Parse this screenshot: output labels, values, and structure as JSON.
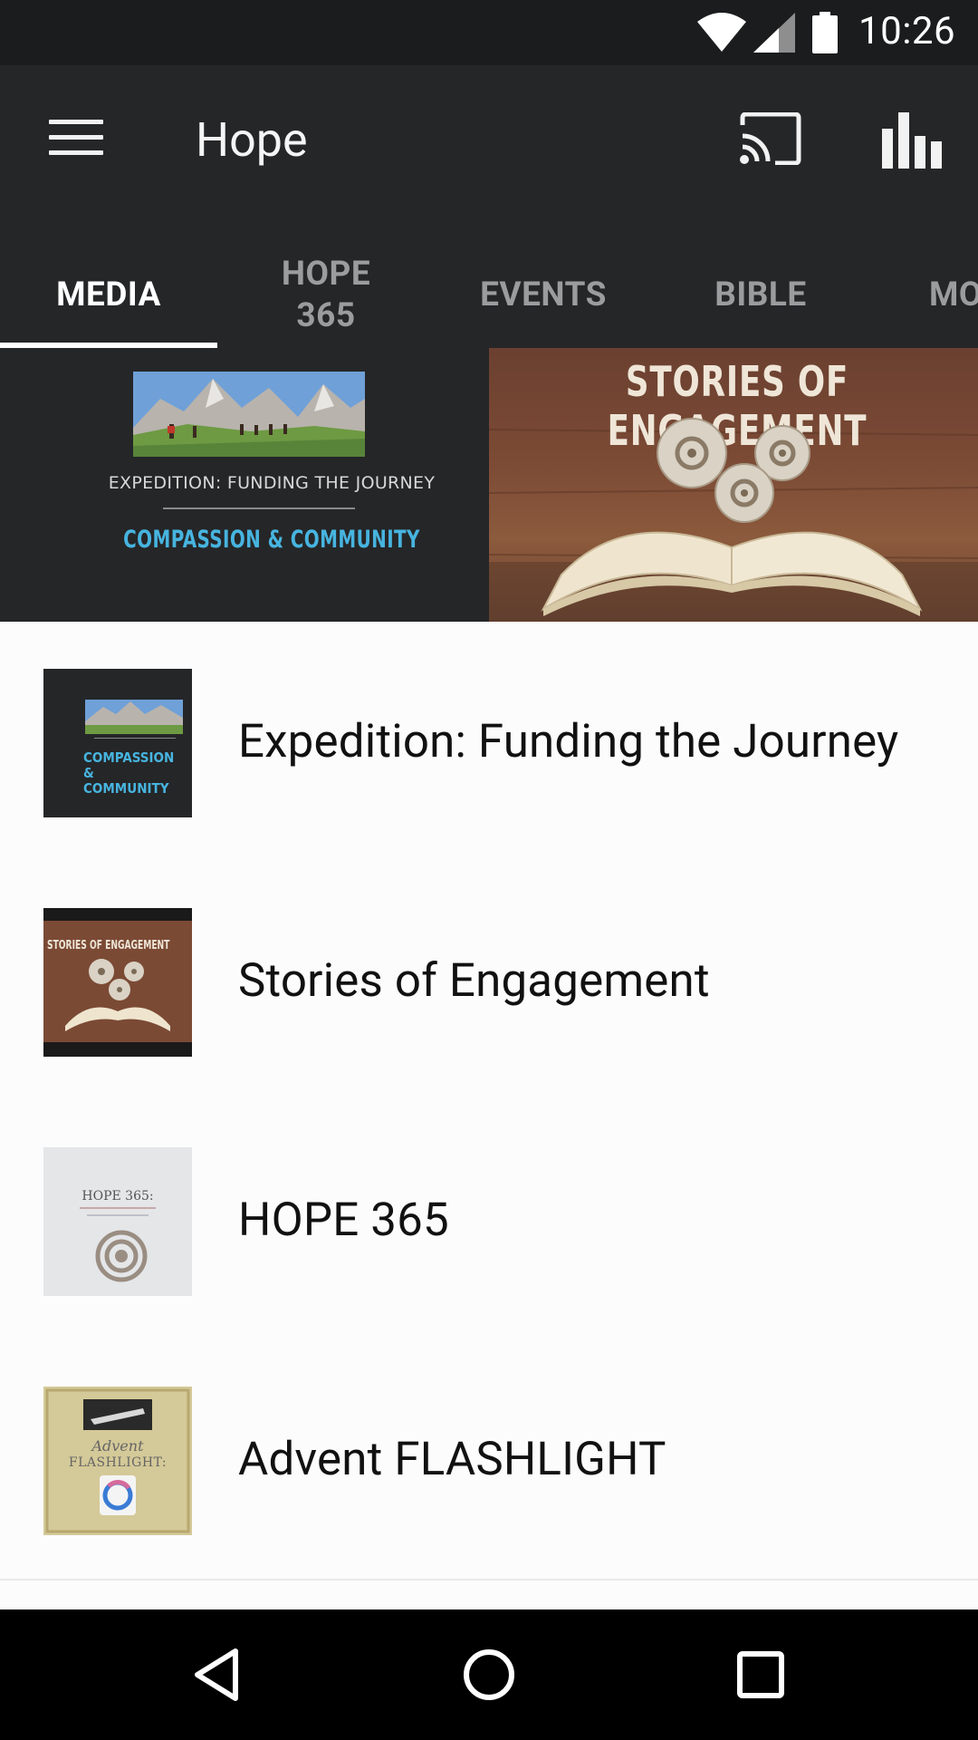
{
  "status_bar": {
    "time": "10:26"
  },
  "app_bar": {
    "title": "Hope",
    "icons": {
      "menu": "menu-icon",
      "cast": "cast-icon",
      "stats": "bar-chart-icon"
    }
  },
  "tabs": [
    {
      "label": "MEDIA",
      "active": true
    },
    {
      "label": "HOPE\n365",
      "active": false
    },
    {
      "label": "EVENTS",
      "active": false
    },
    {
      "label": "BIBLE",
      "active": false
    },
    {
      "label": "MO",
      "active": false
    }
  ],
  "banner": {
    "left": {
      "caption": "EXPEDITION: FUNDING THE JOURNEY",
      "subtitle": "COMPASSION & COMMUNITY"
    },
    "right": {
      "title": "STORIES OF ENGAGEMENT"
    }
  },
  "list": [
    {
      "label": "Expedition: Funding the Journey",
      "thumb": "expedition-thumbnail"
    },
    {
      "label": "Stories of Engagement",
      "thumb": "stories-thumbnail"
    },
    {
      "label": "HOPE 365",
      "thumb": "hope365-thumbnail"
    },
    {
      "label": "Advent FLASHLIGHT",
      "thumb": "advent-thumbnail"
    }
  ],
  "thumb_text": {
    "expedition": "COMPASSION & COMMUNITY",
    "stories": "STORIES OF ENGAGEMENT",
    "hope365": "HOPE 365:",
    "advent1": "Advent",
    "advent2": "FLASHLIGHT:"
  },
  "colors": {
    "status_bar": "#1b1c1d",
    "app_bar": "#252628",
    "tab_active": "#ffffff",
    "tab_inactive": "#9b9c9d",
    "accent_blue": "#47b4df"
  }
}
